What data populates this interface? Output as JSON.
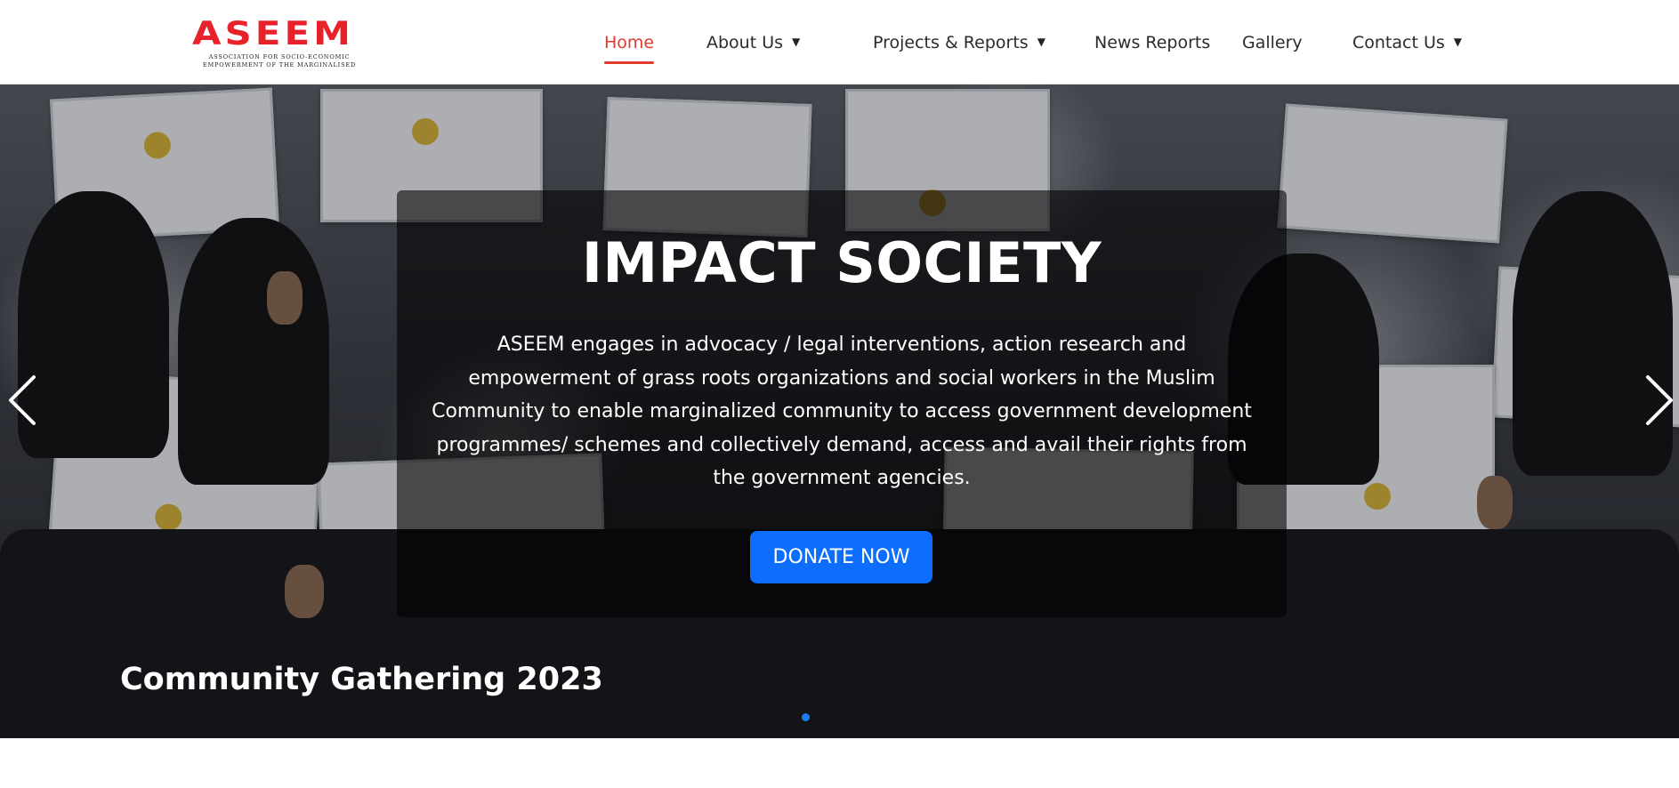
{
  "brand": {
    "name": "ASEEM",
    "tagline_line1": "Association for Socio-Economic",
    "tagline_line2": "Empowerment of the Marginalised",
    "color": "#e8222a"
  },
  "nav": {
    "items": [
      {
        "label": "Home",
        "active": true,
        "has_dropdown": false
      },
      {
        "label": "About Us",
        "active": false,
        "has_dropdown": true
      },
      {
        "label": "Projects & Reports",
        "active": false,
        "has_dropdown": true
      },
      {
        "label": "News Reports",
        "active": false,
        "has_dropdown": false
      },
      {
        "label": "Gallery",
        "active": false,
        "has_dropdown": false
      },
      {
        "label": "Contact Us",
        "active": false,
        "has_dropdown": true
      }
    ],
    "caret": "▼",
    "active_color": "#e23a2c"
  },
  "hero": {
    "title": "IMPACT SOCIETY",
    "text": "ASEEM engages in advocacy / legal interventions, action research and empowerment of grass roots organizations and social workers in the Muslim Community to enable marginalized community to access government development programmes/ schemes and collectively demand, access and avail their rights from the government agencies.",
    "cta_label": "DONATE NOW",
    "cta_color": "#0d6efd",
    "slide_caption": "Community Gathering 2023",
    "prev_icon": "chevron-left-icon",
    "next_icon": "chevron-right-icon",
    "indicator_color": "#1e7bf2",
    "active_slide": 1,
    "slide_count": 1
  }
}
